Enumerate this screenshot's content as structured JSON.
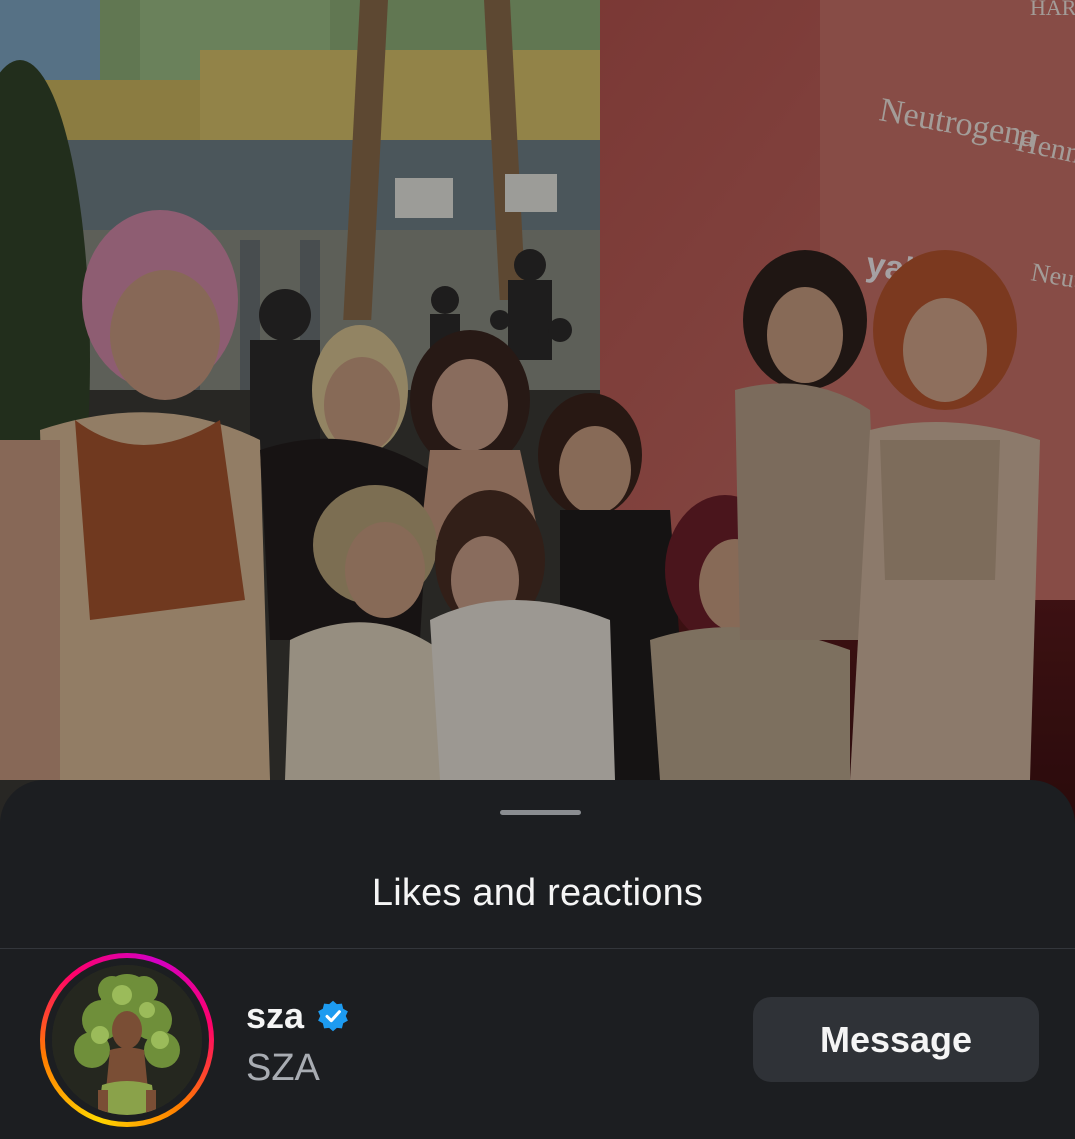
{
  "photo": {
    "description_icon": "group-photo",
    "backdrop_brands": [
      "Neutrogena",
      "Hennessy",
      "yahoo",
      "Neutrogena",
      "HARBO"
    ]
  },
  "sheet": {
    "title": "Likes and reactions"
  },
  "reactions": [
    {
      "username": "sza",
      "full_name": "SZA",
      "verified": true,
      "action_label": "Message"
    }
  ],
  "colors": {
    "sheet_bg": "#1c1e21",
    "button_bg": "#2f3237",
    "verified_blue": "#1d9bf0",
    "secondary_text": "#a8acb2"
  }
}
